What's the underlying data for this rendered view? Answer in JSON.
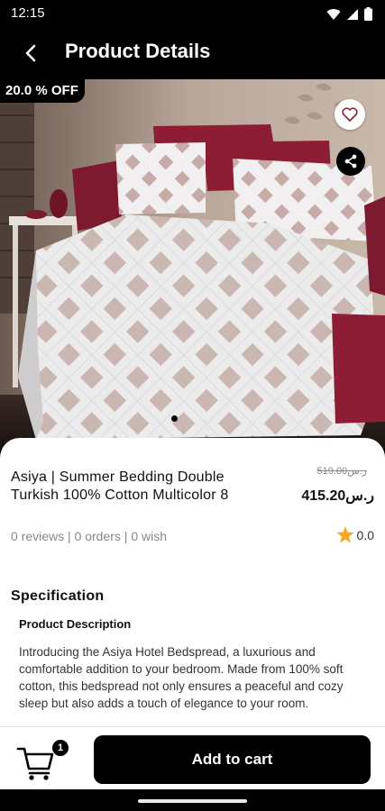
{
  "status": {
    "time": "12:15"
  },
  "header": {
    "title": "Product Details"
  },
  "product": {
    "discount": "20.0 % OFF",
    "name": "Asiya | Summer Bedding Double Turkish 100% Cotton Multicolor 8",
    "old_price": "519.00ر.س",
    "new_price": "415.20ر.س",
    "stats": "0 reviews | 0 orders | 0 wish",
    "rating": "0.0",
    "carousel_index": 0
  },
  "specification": {
    "title": "Specification",
    "description_title": "Product Description",
    "description": "Introducing the Asiya Hotel Bedspread, a luxurious and comfortable addition to your bedroom. Made from 100% soft cotton, this bedspread not only ensures a peaceful and cozy sleep but also adds a touch of elegance to your room."
  },
  "cart": {
    "count": "1",
    "add_label": "Add to cart"
  },
  "colors": {
    "accent": "#000000",
    "star": "#f5a623",
    "pillow": "#8c1d34"
  }
}
